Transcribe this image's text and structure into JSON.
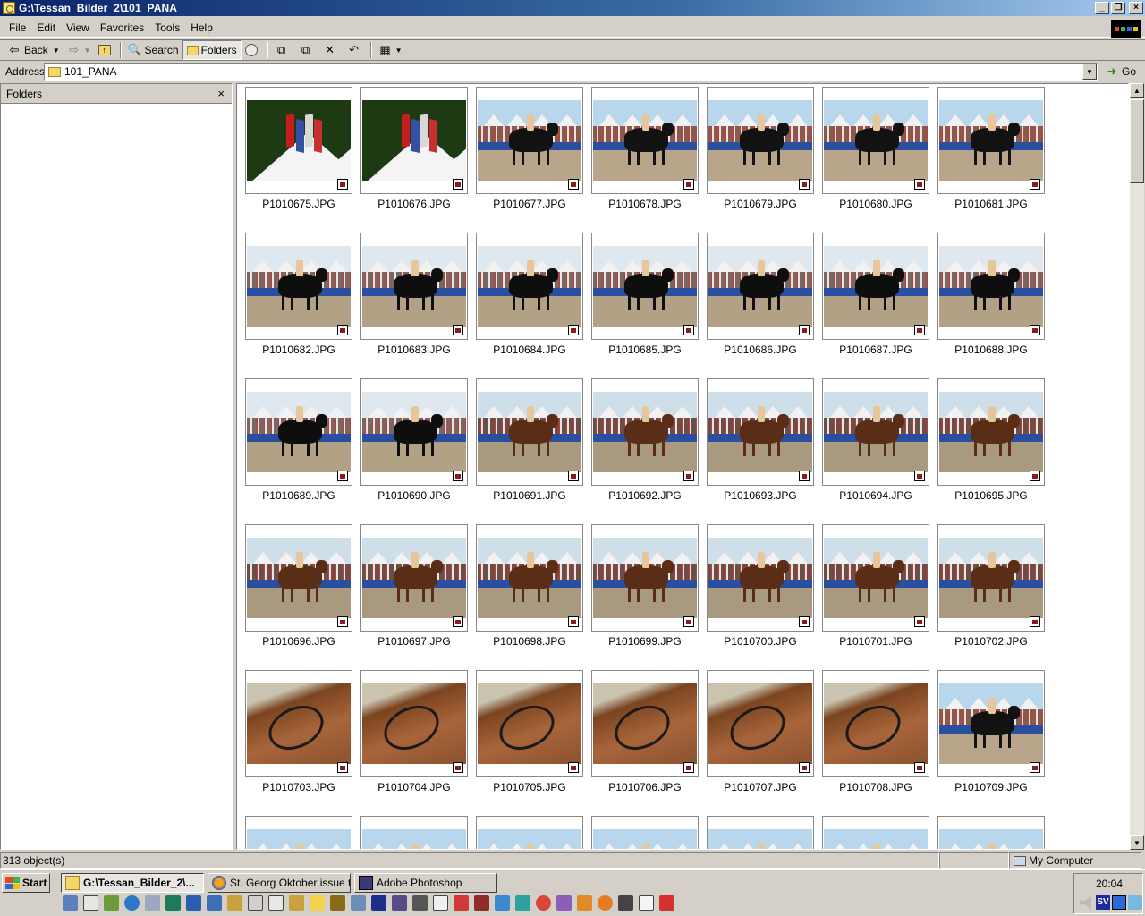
{
  "window": {
    "title": "G:\\Tessan_Bilder_2\\101_PANA",
    "minimize": "_",
    "maximize": "❐",
    "close": "×"
  },
  "menu": [
    "File",
    "Edit",
    "View",
    "Favorites",
    "Tools",
    "Help"
  ],
  "toolbar": {
    "back": "Back",
    "search": "Search",
    "folders": "Folders"
  },
  "address": {
    "label": "Address",
    "value": "101_PANA",
    "go": "Go"
  },
  "folders_pane": {
    "title": "Folders",
    "close": "×"
  },
  "files": [
    {
      "name": "P1010675.JPG",
      "scene": "flags"
    },
    {
      "name": "P1010676.JPG",
      "scene": "flags"
    },
    {
      "name": "P1010677.JPG",
      "scene": "arena"
    },
    {
      "name": "P1010678.JPG",
      "scene": "arena"
    },
    {
      "name": "P1010679.JPG",
      "scene": "arena"
    },
    {
      "name": "P1010680.JPG",
      "scene": "arena"
    },
    {
      "name": "P1010681.JPG",
      "scene": "arena"
    },
    {
      "name": "P1010682.JPG",
      "scene": "black"
    },
    {
      "name": "P1010683.JPG",
      "scene": "black"
    },
    {
      "name": "P1010684.JPG",
      "scene": "black"
    },
    {
      "name": "P1010685.JPG",
      "scene": "black"
    },
    {
      "name": "P1010686.JPG",
      "scene": "black"
    },
    {
      "name": "P1010687.JPG",
      "scene": "black"
    },
    {
      "name": "P1010688.JPG",
      "scene": "black"
    },
    {
      "name": "P1010689.JPG",
      "scene": "black"
    },
    {
      "name": "P1010690.JPG",
      "scene": "black"
    },
    {
      "name": "P1010691.JPG",
      "scene": "bay"
    },
    {
      "name": "P1010692.JPG",
      "scene": "bay"
    },
    {
      "name": "P1010693.JPG",
      "scene": "bay"
    },
    {
      "name": "P1010694.JPG",
      "scene": "bay"
    },
    {
      "name": "P1010695.JPG",
      "scene": "bay"
    },
    {
      "name": "P1010696.JPG",
      "scene": "bay"
    },
    {
      "name": "P1010697.JPG",
      "scene": "bay"
    },
    {
      "name": "P1010698.JPG",
      "scene": "bay"
    },
    {
      "name": "P1010699.JPG",
      "scene": "bay"
    },
    {
      "name": "P1010700.JPG",
      "scene": "bay"
    },
    {
      "name": "P1010701.JPG",
      "scene": "bay"
    },
    {
      "name": "P1010702.JPG",
      "scene": "bay"
    },
    {
      "name": "P1010703.JPG",
      "scene": "closeup"
    },
    {
      "name": "P1010704.JPG",
      "scene": "closeup"
    },
    {
      "name": "P1010705.JPG",
      "scene": "closeup"
    },
    {
      "name": "P1010706.JPG",
      "scene": "closeup"
    },
    {
      "name": "P1010707.JPG",
      "scene": "closeup"
    },
    {
      "name": "P1010708.JPG",
      "scene": "closeup"
    },
    {
      "name": "P1010709.JPG",
      "scene": "arena"
    },
    {
      "name": "",
      "scene": "arena"
    },
    {
      "name": "",
      "scene": "arena"
    },
    {
      "name": "",
      "scene": "arena"
    },
    {
      "name": "",
      "scene": "arena"
    },
    {
      "name": "",
      "scene": "arena"
    },
    {
      "name": "",
      "scene": "arena"
    },
    {
      "name": "",
      "scene": "arena"
    }
  ],
  "status": {
    "count": "313 object(s)",
    "location": "My Computer"
  },
  "taskbar": {
    "start": "Start",
    "tasks": [
      {
        "label": "G:\\Tessan_Bilder_2\\...",
        "active": true
      },
      {
        "label": "St. Georg Oktober issue tr...",
        "active": false
      },
      {
        "label": "Adobe Photoshop",
        "active": false
      }
    ],
    "clock": "20:04",
    "tray_lang": "SV"
  },
  "colors": {
    "titlebar": "#0a246a",
    "face": "#d4d0c8",
    "sand": "#b9a68a",
    "banner": "#2a4fa0"
  }
}
